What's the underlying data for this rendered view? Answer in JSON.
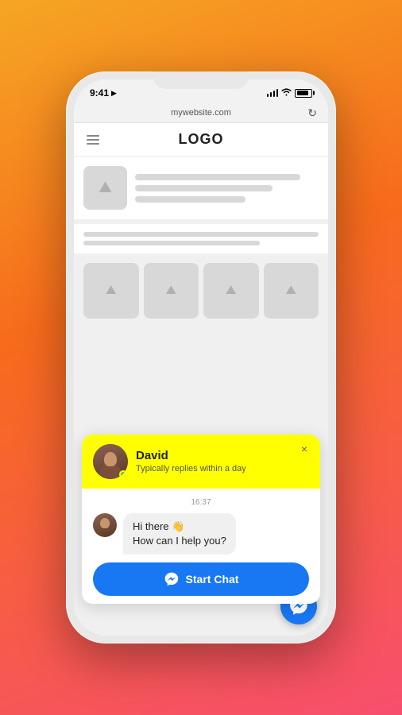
{
  "phone": {
    "status_bar": {
      "time": "9:41",
      "location_arrow": "▶",
      "battery_level": 85
    },
    "browser": {
      "url": "mywebsite.com",
      "refresh_icon": "↻"
    },
    "website": {
      "logo": "LOGO",
      "menu_icon": "≡"
    },
    "chat_popup": {
      "close_icon": "×",
      "agent_name": "David",
      "agent_subtitle": "Typically replies within a day",
      "timestamp": "16:37",
      "message_line1": "Hi there 👋",
      "message_line2": "How can I help you?",
      "start_chat_label": "Start Chat"
    }
  }
}
